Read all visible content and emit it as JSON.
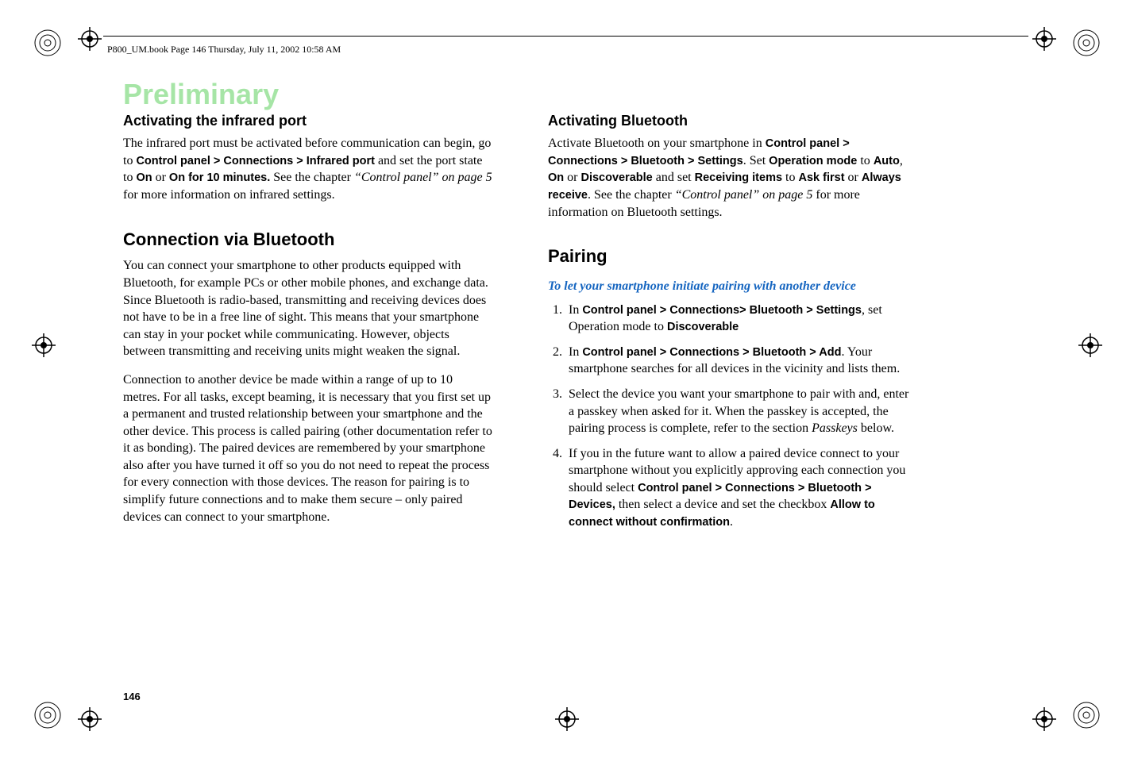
{
  "header": {
    "line": "P800_UM.book  Page 146  Thursday, July 11, 2002  10:58 AM"
  },
  "watermark": "Preliminary",
  "page_number": "146",
  "left_col": {
    "h3_1": "Activating the infrared port",
    "p1_a": "The infrared port must be activated before communication can begin, go to ",
    "p1_b": "Control panel > Connections > Infrared port",
    "p1_c": " and set the port state to ",
    "p1_d": "On",
    "p1_e": " or ",
    "p1_f": "On for 10 minutes.",
    "p1_g": " See the chapter ",
    "p1_h": "“Control panel” on page 5",
    "p1_i": " for more information on infrared settings.",
    "h2_1": "Connection via Bluetooth",
    "p2": "You can connect your smartphone to other products equipped with Bluetooth, for example PCs or other mobile phones, and exchange data. Since Bluetooth is radio-based, transmitting and receiving devices does not have to be in a free line of sight. This means that your smartphone can stay in your pocket while communicating. However, objects between transmitting and receiving units might weaken the signal.",
    "p3": "Connection to another device be made within a range of up to 10 metres. For all tasks, except beaming, it is necessary that you first set up a permanent and trusted relationship between your smartphone and the other device. This process is called pairing (other documentation refer to it as bonding). The paired devices are remembered by your smartphone also after you have turned it off so you do not need to repeat the process for every connection with those devices. The reason for pairing is to simplify future connections and to make them secure – only paired devices can connect to your smartphone."
  },
  "right_col": {
    "h3_1": "Activating Bluetooth",
    "p1_a": "Activate Bluetooth on your smartphone in ",
    "p1_b": "Control panel > Connections > Bluetooth > Settings",
    "p1_c": ". Set ",
    "p1_d": "Operation mode",
    "p1_e": " to ",
    "p1_f": "Auto",
    "p1_g": ", ",
    "p1_h": "On",
    "p1_i": " or ",
    "p1_j": "Discoverable",
    "p1_k": " and set ",
    "p1_l": "Receiving items",
    "p1_m": " to ",
    "p1_n": "Ask first",
    "p1_o": " or ",
    "p1_p": "Always receive",
    "p1_q": ". See the chapter ",
    "p1_r": "“Control panel” on page 5",
    "p1_s": " for more information on Bluetooth settings.",
    "h2_1": "Pairing",
    "h4_1": "To let your smartphone initiate pairing with another device",
    "li1_a": "In ",
    "li1_b": "Control panel > Connections> Bluetooth > Settings",
    "li1_c": ", set Operation mode to ",
    "li1_d": "Discoverable",
    "li2_a": "In ",
    "li2_b": "Control panel > Connections > Bluetooth > Add",
    "li2_c": ". Your smartphone searches for all devices in the vicinity and lists them.",
    "li3_a": "Select the device you want your smartphone to pair with and, enter a passkey when asked for it. When the passkey is accepted, the pairing process is complete, refer to the section ",
    "li3_b": "Passkeys",
    "li3_c": " below.",
    "li4_a": "If you in the future want to allow a paired device connect to your smartphone without you explicitly approving each connection you should select ",
    "li4_b": "Control panel > Connections > Bluetooth > Devices,",
    "li4_c": " then select a device and set the checkbox ",
    "li4_d": "Allow to connect without confirmation",
    "li4_e": "."
  }
}
